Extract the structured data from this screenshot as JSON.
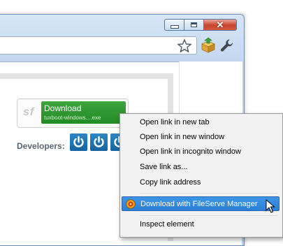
{
  "window": {
    "minimize_icon": "minimize-icon",
    "maximize_icon": "maximize-icon",
    "close_icon": "close-icon"
  },
  "toolbar": {
    "bookmark_icon": "star-icon",
    "extension_icon": "fileserve-box-icon",
    "settings_icon": "wrench-icon"
  },
  "page": {
    "logo_text": "sf",
    "download_button": {
      "label": "Download",
      "filename": "tuxboot-windows....exe"
    },
    "developers_label": "Developers:"
  },
  "context_menu": {
    "items": [
      {
        "label": "Open link in new tab"
      },
      {
        "label": "Open link in new window"
      },
      {
        "label": "Open link in incognito window"
      },
      {
        "label": "Save link as..."
      },
      {
        "label": "Copy link address"
      },
      {
        "label": "Download with FileServe Manager",
        "active": true
      },
      {
        "label": "Inspect element"
      }
    ]
  },
  "colors": {
    "accent_blue": "#2b7fd7",
    "download_green": "#238b23",
    "developer_blue": "#17649f"
  }
}
